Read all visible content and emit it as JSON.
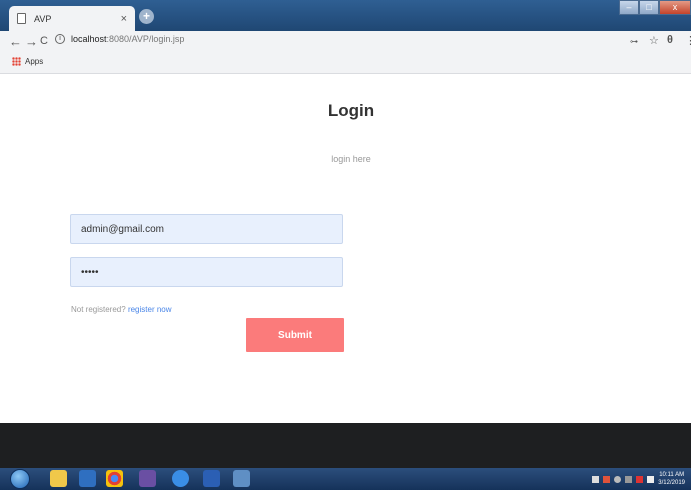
{
  "browser": {
    "tab_title": "AVP",
    "tab_close": "×",
    "new_tab": "+",
    "window_controls": [
      "–",
      "□",
      "x"
    ],
    "back": "←",
    "forward": "→",
    "reload": "C",
    "url_host": "localhost",
    "url_path": ":8080/AVP/login.jsp",
    "key_icon": "⊶",
    "star_icon": "☆",
    "profile_icon": "θ",
    "menu_icon": "⋮",
    "bookmarks": {
      "apps_label": "Apps"
    }
  },
  "login": {
    "heading": "Login",
    "subheading": "login here",
    "email_value": "admin@gmail.com",
    "password_value": "•••••",
    "not_registered": "Not registered?",
    "register_link": "register now",
    "submit_label": "Submit"
  },
  "taskbar": {
    "clock_time": "10:11 AM",
    "clock_date": "3/12/2019",
    "icons": [
      "start-orb",
      "file-explorer",
      "media-player",
      "chrome",
      "visual-studio",
      "internet-explorer",
      "word",
      "app"
    ]
  },
  "colors": {
    "submit_bg": "#fb7b7b",
    "input_bg": "#e8f0fd",
    "link": "#4a86e8"
  }
}
